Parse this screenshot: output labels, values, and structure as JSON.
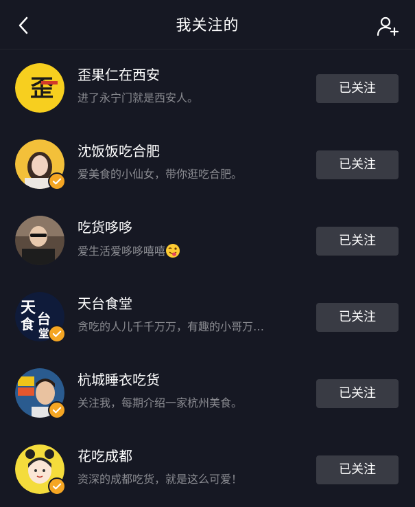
{
  "header": {
    "title": "我关注的",
    "back_icon": "chevron-left-icon",
    "add_friend_icon": "add-user-icon"
  },
  "following": [
    {
      "name": "歪果仁在西安",
      "bio": "进了永宁门就是西安人。",
      "verified": false,
      "button": "已关注"
    },
    {
      "name": "沈饭饭吃合肥",
      "bio": "爱美食的小仙女，带你逛吃合肥。",
      "verified": true,
      "button": "已关注"
    },
    {
      "name": "吃货哆哆",
      "bio": "爱生活爱哆哆嘻嘻",
      "bio_emoji": "winking-tongue-emoji",
      "verified": false,
      "button": "已关注"
    },
    {
      "name": "天台食堂",
      "bio": "贪吃的人儿千千万万，有趣的小哥万…",
      "verified": true,
      "button": "已关注"
    },
    {
      "name": "杭城睡衣吃货",
      "bio": "关注我，每期介绍一家杭州美食。",
      "verified": true,
      "button": "已关注"
    },
    {
      "name": "花吃成都",
      "bio": "资深的成都吃货，就是这么可爱！",
      "verified": true,
      "button": "已关注"
    }
  ],
  "colors": {
    "background": "#161823",
    "button": "#393b44",
    "secondary_text": "#8a8b91",
    "verified_badge": "#f5a623"
  }
}
